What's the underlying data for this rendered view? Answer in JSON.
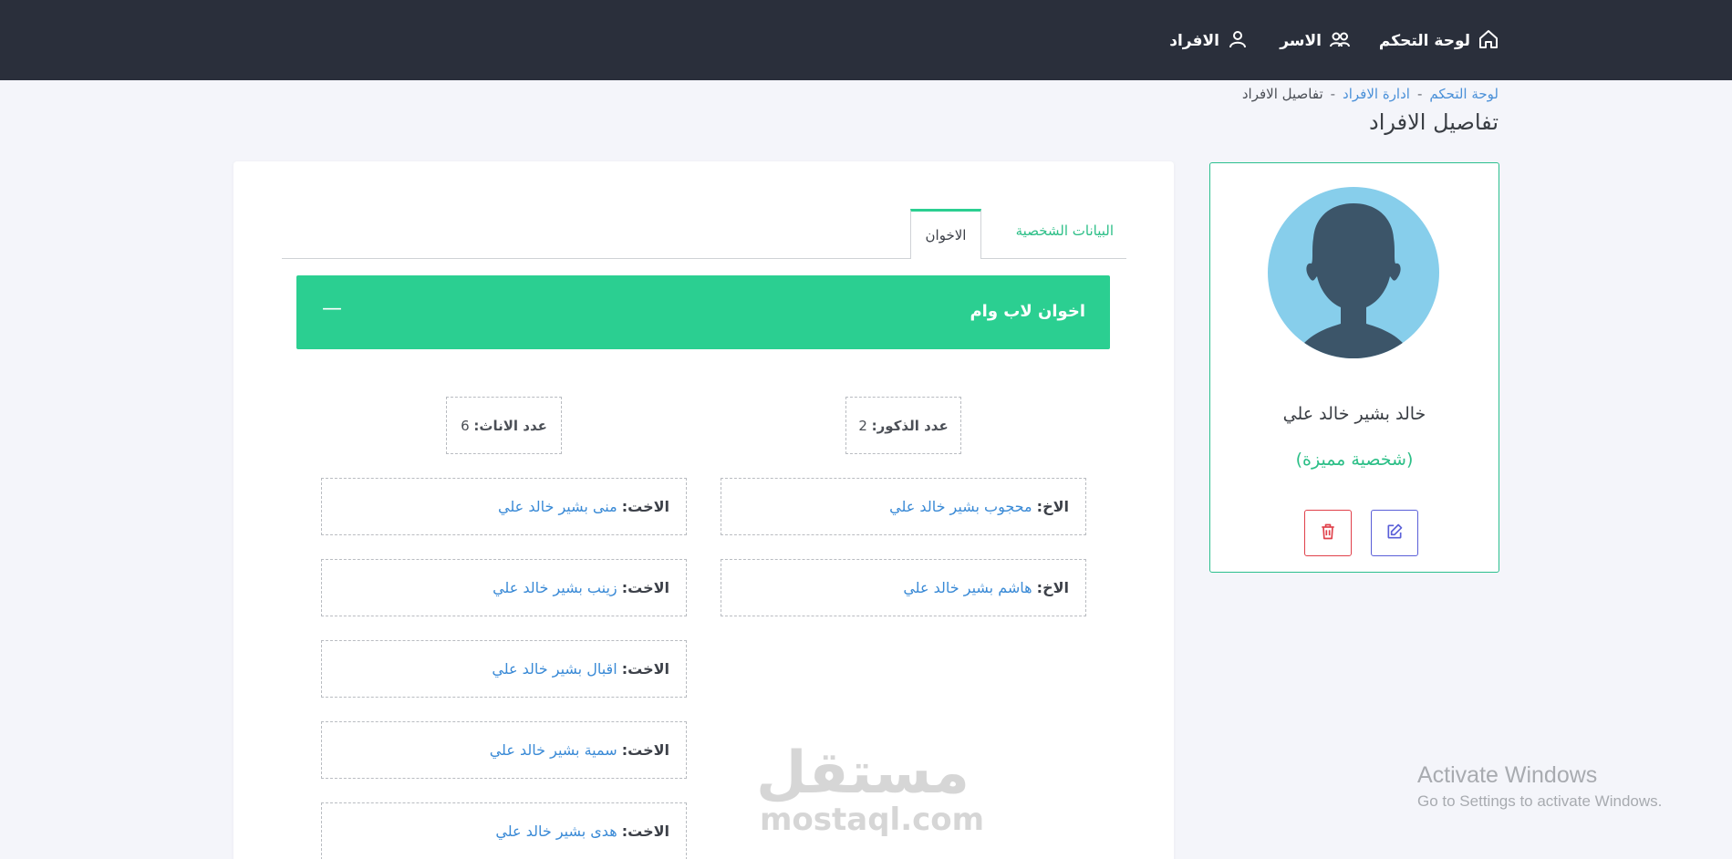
{
  "nav": {
    "home_label": "لوحة التحكم",
    "families_label": "الاسر",
    "members_label": "الافراد"
  },
  "breadcrumb": {
    "home": "لوحة التحكم",
    "members": "ادارة الافراد",
    "current": "تفاصيل الافراد",
    "separator": "-"
  },
  "page": {
    "title": "تفاصيل الافراد"
  },
  "tabs": {
    "personal": "البيانات الشخصية",
    "siblings": "الاخوان"
  },
  "section": {
    "title": "اخوان لاب وام",
    "collapse_symbol": "—"
  },
  "counts": {
    "males_label": "عدد الذكور:",
    "males_value": "2",
    "females_label": "عدد الاناث:",
    "females_value": "6"
  },
  "brothers": [
    {
      "relation": "الاخ:",
      "name": "محجوب بشير خالد علي"
    },
    {
      "relation": "الاخ:",
      "name": "هاشم بشير خالد علي"
    }
  ],
  "sisters": [
    {
      "relation": "الاخت:",
      "name": "منى بشير خالد علي"
    },
    {
      "relation": "الاخت:",
      "name": "زينب بشير خالد علي"
    },
    {
      "relation": "الاخت:",
      "name": "اقبال بشير خالد علي"
    },
    {
      "relation": "الاخت:",
      "name": "سمية بشير خالد علي"
    },
    {
      "relation": "الاخت:",
      "name": "هدى بشير خالد علي"
    }
  ],
  "profile": {
    "name": "خالد بشير خالد علي",
    "status": "(شخصية مميزة)"
  },
  "watermark": {
    "arabic": "مستقل",
    "latin": "mostaql.com"
  },
  "activation": {
    "title": "Activate Windows",
    "subtitle": "Go to Settings to activate Windows."
  },
  "colors": {
    "topbar": "#2a2f3b",
    "accent_green": "#2bcf91",
    "link_blue": "#3a8ad6",
    "edit_blue": "#5a5fd8",
    "delete_red": "#e0404a",
    "avatar_bg": "#87ceeb",
    "avatar_silhouette": "#3c5569"
  }
}
